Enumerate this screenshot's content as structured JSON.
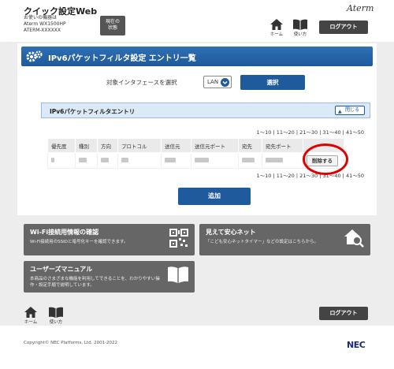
{
  "header": {
    "app_title": "クイック設定Web",
    "model_line1": "お使いの機器は",
    "model_line2": "Aterm WX1500HP",
    "model_line3": "ATERM-XXXXXX",
    "status_line1": "現在の",
    "status_line2": "状態",
    "brand": "Aterm",
    "home_label": "ホーム",
    "manual_label": "使い方",
    "logout_label": "ログアウト"
  },
  "main": {
    "title": "IPv6パケットフィルタ設定 エントリ一覧",
    "interface_label": "対象インタフェースを選択",
    "interface_value": "LAN",
    "select_label": "選択",
    "section_title": "IPv6パケットフィルタエントリ",
    "close_label": "閉じる",
    "pager": [
      "1～10",
      "11～20",
      "21～30",
      "31～40",
      "41～50"
    ],
    "pager_sep": "|",
    "table": {
      "headers": [
        "優先度",
        "種別",
        "方向",
        "プロトコル",
        "送信元",
        "送信元ポート",
        "宛先",
        "宛先ポート"
      ],
      "delete_label": "削除する"
    },
    "add_label": "追加"
  },
  "cards": {
    "wifi_title": "Wi-Fi接続用情報の確認",
    "wifi_desc": "Wi-Fi接続用のSSIDと暗号化キーを確認できます。",
    "safe_title": "見えて安心ネット",
    "safe_desc": "「こども安心ネットタイマー」などの設定はこちらから。",
    "manual_title": "ユーザーズマニュアル",
    "manual_desc1": "本商品のさまざまな機能を利用してできることを、わかりやすい操",
    "manual_desc2": "作・設定手順で説明しています。"
  },
  "footer": {
    "copyright": "Copyright© NEC Platforms, Ltd. 2001-2022",
    "logo": "NEC"
  },
  "colors": {
    "accent": "#1f5a9c",
    "highlight": "#e10000"
  }
}
